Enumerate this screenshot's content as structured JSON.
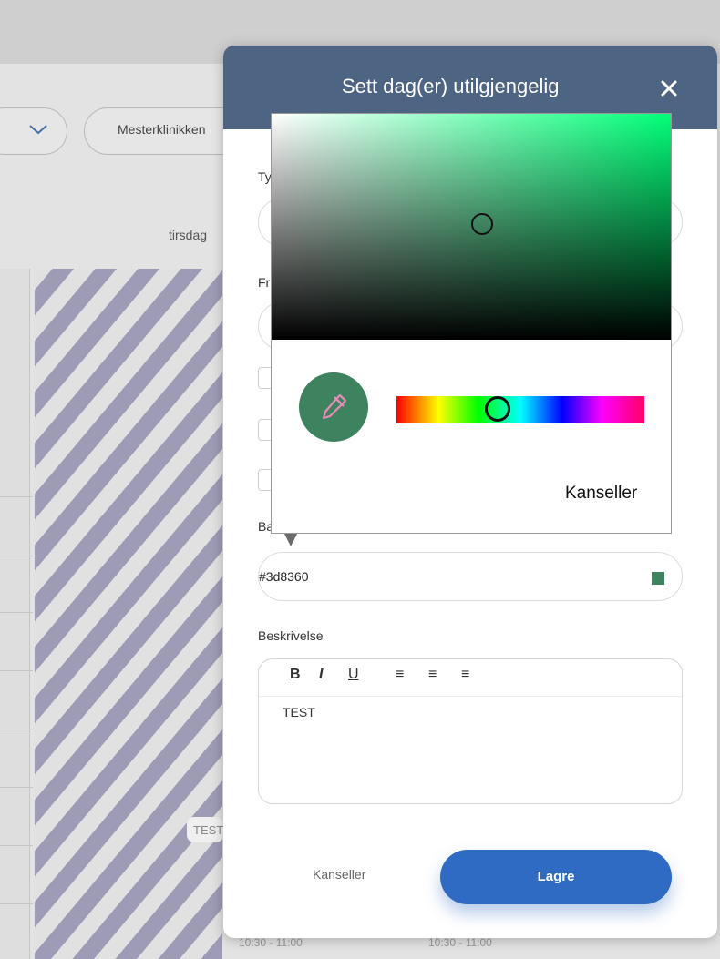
{
  "background": {
    "clinic_button": "Mesterklinikken",
    "day_name": "tirsdag",
    "event_chip": "TEST",
    "times": [
      "10:30 - 11:00",
      "10:30 - 11:00"
    ]
  },
  "modal": {
    "title": "Sett dag(er) utilgjengelig",
    "field_labels": {
      "type": "Ty",
      "from": "Fr",
      "color": "Ba"
    },
    "color_value": "#3d8360",
    "description_label": "Beskrivelse",
    "editor": {
      "bold": "B",
      "italic": "I",
      "underline": "U",
      "align_left": "≡",
      "align_center": "≡",
      "align_right": "≡",
      "content": "TEST"
    },
    "cancel_label": "Kanseller",
    "save_label": "Lagre",
    "colors": {
      "header": "#4e6483",
      "save": "#2f6bc2",
      "selected": "#3d8360"
    }
  },
  "color_picker": {
    "selected_color": "#3d8360",
    "cancel_label": "Kanseller",
    "eyedropper_icon": "eyedropper-icon"
  }
}
